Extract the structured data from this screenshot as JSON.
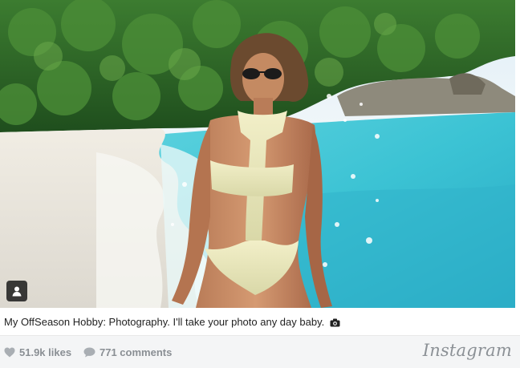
{
  "post": {
    "caption": "My OffSeason Hobby: Photography. I'll take your photo any day baby.",
    "likes": "51.9k likes",
    "comments": "771 comments",
    "brand": "Instagram",
    "photo_icon": "person-tag-icon",
    "caption_icon": "camera-icon"
  },
  "colors": {
    "sky": "#eaf3f8",
    "sea": "#3fc6d6",
    "sand": "#e9e6de",
    "jungle": "#2f6b2a",
    "footer": "#f4f5f6",
    "muted_text": "#8a8f94"
  }
}
